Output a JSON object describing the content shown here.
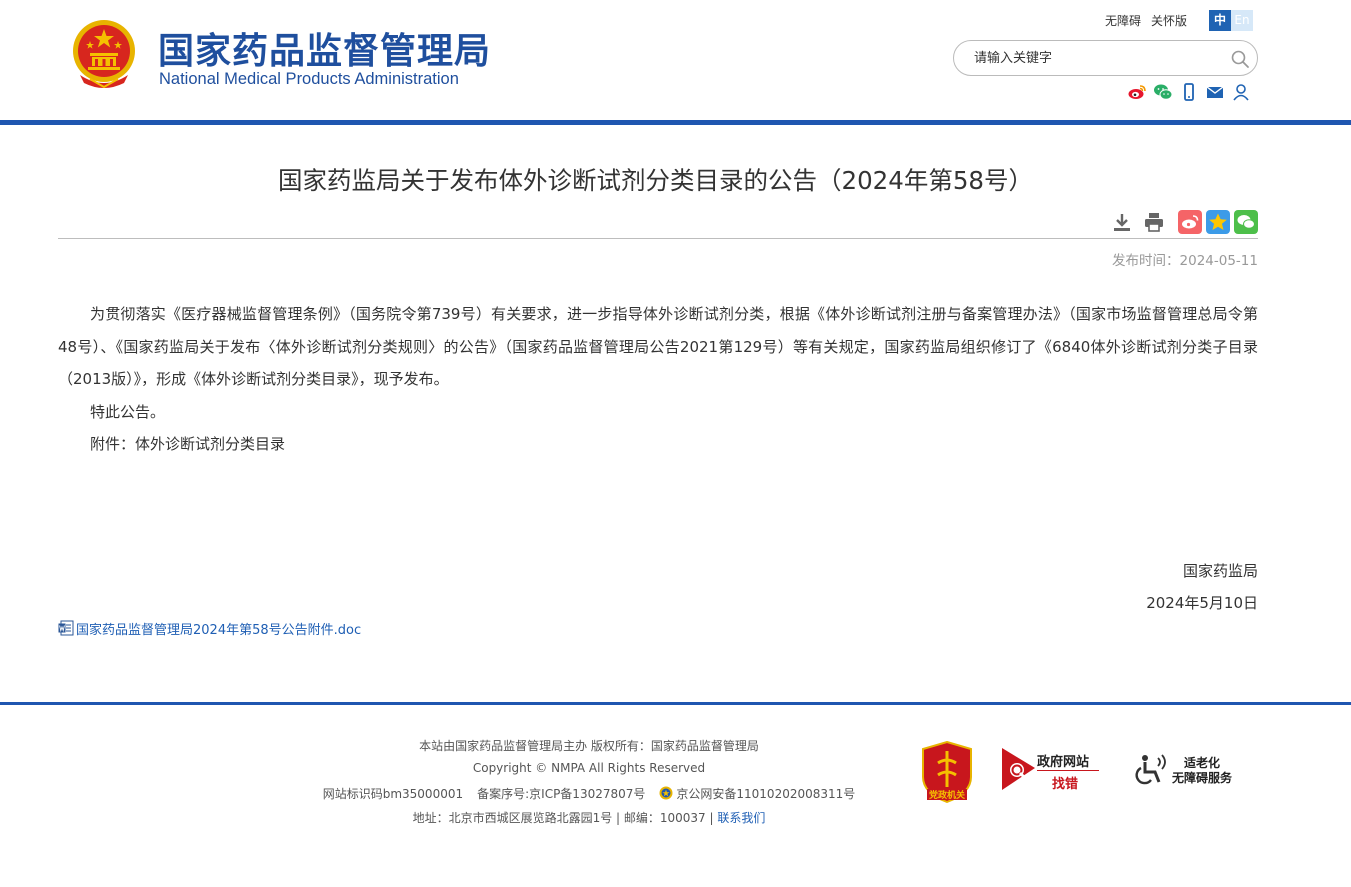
{
  "header": {
    "site_name_cn": "国家药品监督管理局",
    "site_name_en": "National Medical Products Administration",
    "top_links": [
      "无障碍",
      "关怀版"
    ],
    "lang": {
      "cn": "中",
      "en": "En"
    },
    "search": {
      "placeholder": "请输入关键字"
    },
    "social_icons": [
      "weibo-icon",
      "wechat-icon",
      "mobile-icon",
      "mail-icon",
      "user-icon"
    ],
    "colors": {
      "brand_blue": "#1f56b0",
      "title_blue": "#1f4f9e",
      "emblem_red": "#d7261e",
      "emblem_gold": "#f5c000"
    }
  },
  "article": {
    "title": "国家药监局关于发布体外诊断试剂分类目录的公告（2024年第58号）",
    "tool_icons": [
      "download-icon",
      "print-icon",
      "share-weibo-icon",
      "share-qzone-icon",
      "share-wechat-icon"
    ],
    "publish_label": "发布时间：",
    "publish_date": "2024-05-11",
    "paragraphs": [
      "为贯彻落实《医疗器械监督管理条例》（国务院令第739号）有关要求，进一步指导体外诊断试剂分类，根据《体外诊断试剂注册与备案管理办法》（国家市场监督管理总局令第48号）、《国家药监局关于发布〈体外诊断试剂分类规则〉的公告》（国家药品监督管理局公告2021第129号）等有关规定，国家药监局组织修订了《6840体外诊断试剂分类子目录（2013版）》，形成《体外诊断试剂分类目录》，现予发布。",
      "特此公告。",
      "附件：体外诊断试剂分类目录"
    ],
    "signature_org": "国家药监局",
    "signature_date": "2024年5月10日",
    "attachment_link": "国家药品监督管理局2024年第58号公告附件.doc"
  },
  "footer": {
    "sponsor": "本站由国家药品监督管理局主办 版权所有：国家药品监督管理局",
    "copyright": "Copyright © NMPA All Rights Reserved",
    "site_id": "网站标识码bm35000001",
    "icp": "备案序号:京ICP备13027807号",
    "police": "京公网安备11010202008311号",
    "address": "地址：北京市西城区展览路北露园1号 | 邮编：100037 |",
    "contact": "联系我们",
    "party_badge_text": "党政机关",
    "gov_findbug": {
      "line1": "政府网站",
      "line2": "找错"
    },
    "accessible": {
      "line1": "适老化",
      "line2": "无障碍服务"
    }
  }
}
